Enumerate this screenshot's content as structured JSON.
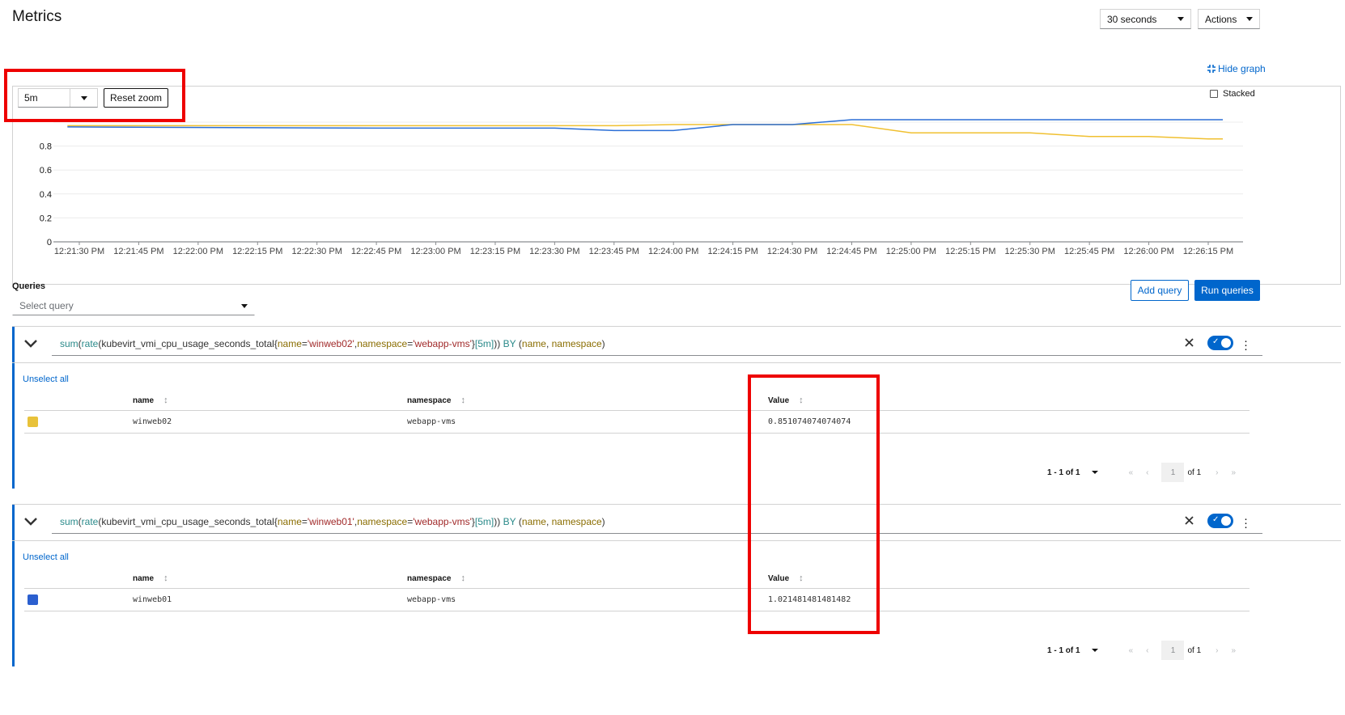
{
  "header": {
    "title": "Metrics",
    "refresh_interval": "30 seconds",
    "actions_label": "Actions"
  },
  "graph": {
    "hide_graph_label": "Hide graph",
    "time_range": "5m",
    "reset_zoom_label": "Reset zoom",
    "stacked_label": "Stacked",
    "stacked_checked": false
  },
  "chart_data": {
    "type": "line",
    "y_ticks": [
      "0",
      "0.2",
      "0.4",
      "0.6",
      "0.8"
    ],
    "ylim": [
      0,
      1
    ],
    "x_ticks": [
      "12:21:30 PM",
      "12:21:45 PM",
      "12:22:00 PM",
      "12:22:15 PM",
      "12:22:30 PM",
      "12:22:45 PM",
      "12:23:00 PM",
      "12:23:15 PM",
      "12:23:30 PM",
      "12:23:45 PM",
      "12:24:00 PM",
      "12:24:15 PM",
      "12:24:30 PM",
      "12:24:45 PM",
      "12:25:00 PM",
      "12:25:15 PM",
      "12:25:30 PM",
      "12:25:45 PM",
      "12:26:00 PM",
      "12:26:15 PM"
    ],
    "grid": true,
    "series": [
      {
        "name": "winweb02",
        "color": "#f0c030",
        "x": [
          "12:21:27 PM",
          "12:22:45 PM",
          "12:23:45 PM",
          "12:24:00 PM",
          "12:24:45 PM",
          "12:25:00 PM",
          "12:25:15 PM",
          "12:25:30 PM",
          "12:25:45 PM",
          "12:26:00 PM",
          "12:26:15 PM",
          "12:26:30 PM"
        ],
        "values": [
          0.97,
          0.97,
          0.97,
          0.98,
          0.98,
          0.91,
          0.91,
          0.91,
          0.88,
          0.88,
          0.86,
          0.86
        ]
      },
      {
        "name": "winweb01",
        "color": "#2b6fd6",
        "x": [
          "12:21:27 PM",
          "12:22:45 PM",
          "12:23:30 PM",
          "12:23:45 PM",
          "12:24:00 PM",
          "12:24:15 PM",
          "12:24:30 PM",
          "12:24:45 PM",
          "12:25:00 PM",
          "12:25:30 PM",
          "12:26:00 PM",
          "12:26:30 PM"
        ],
        "values": [
          0.96,
          0.95,
          0.95,
          0.93,
          0.93,
          0.98,
          0.98,
          1.02,
          1.02,
          1.02,
          1.02,
          1.02
        ]
      }
    ]
  },
  "queries": {
    "heading": "Queries",
    "select_placeholder": "Select query",
    "add_query_label": "Add query",
    "run_queries_label": "Run queries",
    "items": [
      {
        "expr": {
          "fn1": "sum",
          "p1": "(",
          "fn2": "rate",
          "p2": "(",
          "metric": "kubevirt_vmi_cpu_usage_seconds_total",
          "b1": "{",
          "l1": "name",
          "eq1": "=",
          "v1": "'winweb02'",
          "c1": ",",
          "l2": "namespace",
          "eq2": "=",
          "v2": "'webapp-vms'",
          "b2": "}",
          "range": "[5m]",
          "p3": "))",
          "kw": "BY",
          "p4": "(",
          "g1": "name",
          "c2": ", ",
          "g2": "namespace",
          "p5": ")"
        },
        "unselect_label": "Unselect all",
        "columns": [
          "name",
          "namespace",
          "Value"
        ],
        "rows": [
          {
            "name": "winweb02",
            "namespace": "webapp-vms",
            "value": "0.851074074074074",
            "color": "#e8c23a"
          }
        ],
        "pagination": {
          "range": "1 - 1 of 1",
          "page": "1",
          "of": "of 1"
        }
      },
      {
        "expr": {
          "fn1": "sum",
          "p1": "(",
          "fn2": "rate",
          "p2": "(",
          "metric": "kubevirt_vmi_cpu_usage_seconds_total",
          "b1": "{",
          "l1": "name",
          "eq1": "=",
          "v1": "'winweb01'",
          "c1": ",",
          "l2": "namespace",
          "eq2": "=",
          "v2": "'webapp-vms'",
          "b2": "}",
          "range": "[5m]",
          "p3": "))",
          "kw": "BY",
          "p4": "(",
          "g1": "name",
          "c2": ", ",
          "g2": "namespace",
          "p5": ")"
        },
        "unselect_label": "Unselect all",
        "columns": [
          "name",
          "namespace",
          "Value"
        ],
        "rows": [
          {
            "name": "winweb01",
            "namespace": "webapp-vms",
            "value": "1.021481481481482",
            "color": "#2b5fcf"
          }
        ],
        "pagination": {
          "range": "1 - 1 of 1",
          "page": "1",
          "of": "of 1"
        }
      }
    ]
  },
  "icons": {
    "chevron": "chevron-down-icon",
    "clear": "close-icon",
    "kebab": "kebab-icon",
    "compress": "compress-icon",
    "sort": "sort-icon"
  }
}
